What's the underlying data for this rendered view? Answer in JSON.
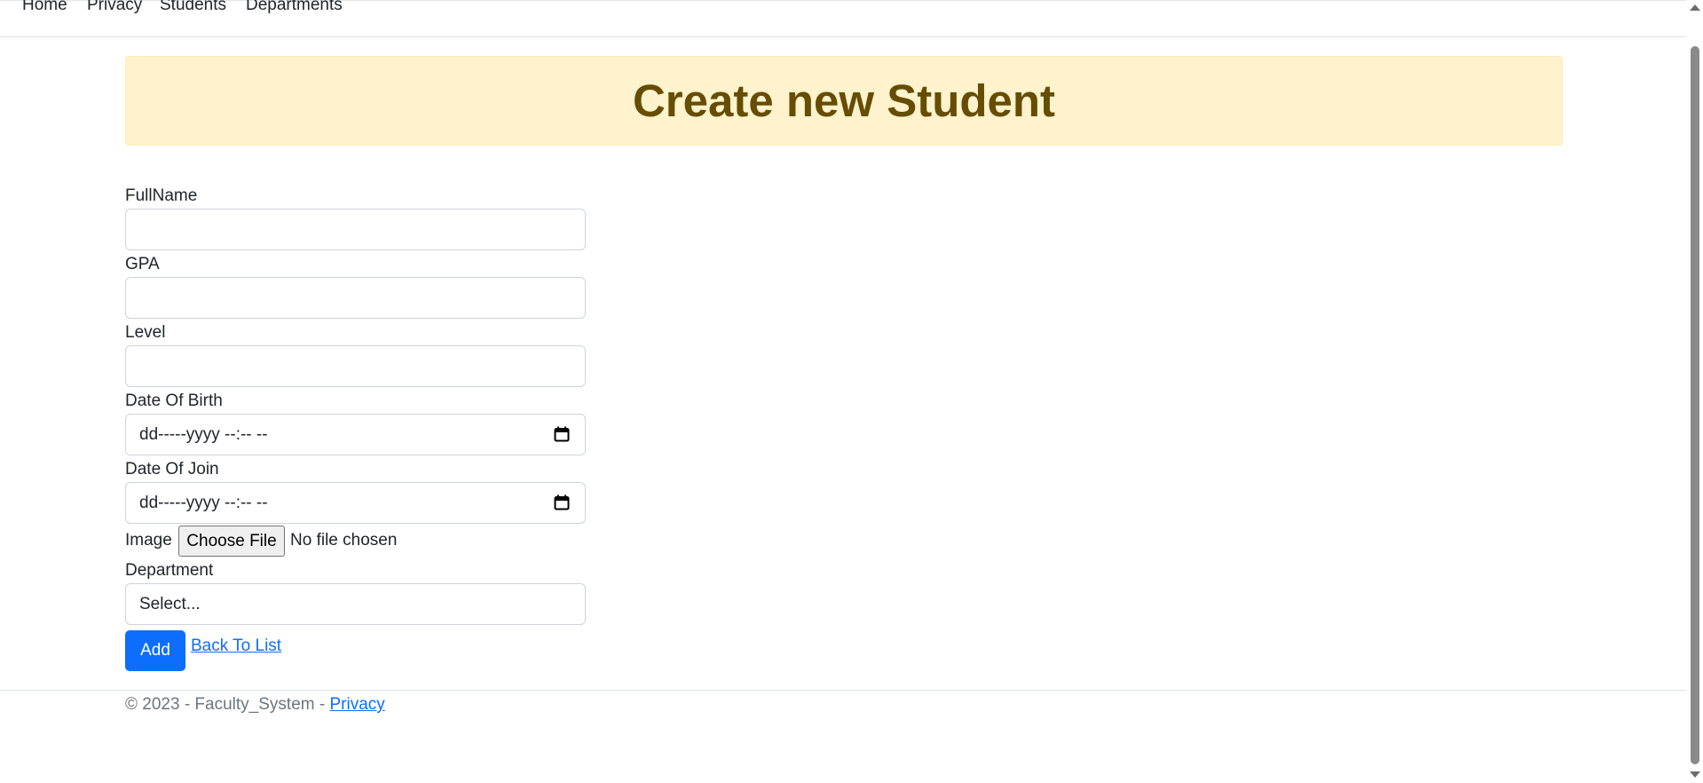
{
  "nav": {
    "items": [
      "Home",
      "Privacy",
      "Students",
      "Departments"
    ]
  },
  "alert": {
    "title": "Create new Student"
  },
  "form": {
    "fullname_label": "FullName",
    "gpa_label": "GPA",
    "level_label": "Level",
    "dob_label": "Date Of Birth",
    "dob_placeholder": "dd-----yyyy --:-- --",
    "doj_label": "Date Of Join",
    "doj_placeholder": "dd-----yyyy --:-- --",
    "image_label": "Image",
    "file_button": "Choose File",
    "file_status": "No file chosen",
    "department_label": "Department",
    "department_selected": "Select...",
    "add_button": "Add",
    "back_link": "Back To List"
  },
  "footer": {
    "text": "© 2023 - Faculty_System - ",
    "privacy_link": "Privacy"
  },
  "colors": {
    "primary": "#0d6efd",
    "alert_bg": "#fff3cd",
    "alert_text": "#664d03"
  },
  "icons": [
    "calendar-icon",
    "scroll-up-arrow",
    "scroll-down-arrow"
  ]
}
